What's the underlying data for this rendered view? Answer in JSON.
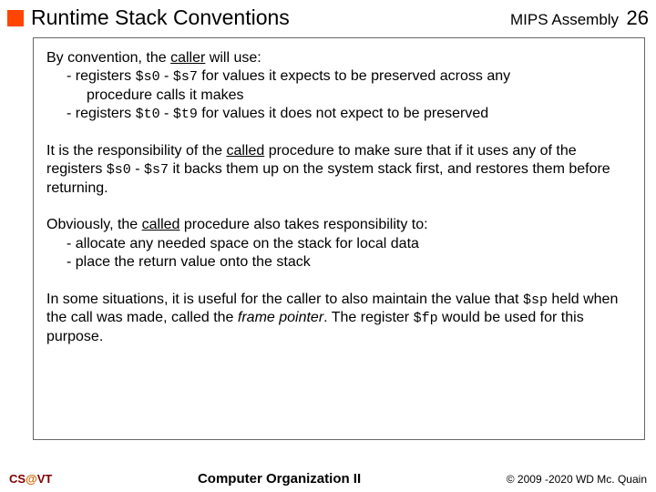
{
  "header": {
    "title": "Runtime Stack Conventions",
    "subject": "MIPS Assembly",
    "page": "26"
  },
  "body": {
    "p1_lead": "By convention, the ",
    "p1_caller": "caller",
    "p1_tail": " will use:",
    "b1_a": "-  registers ",
    "b1_reg1": "$s0",
    "b1_mid": " - ",
    "b1_reg2": "$s7",
    "b1_b": " for values it expects to be preserved across any",
    "b1_c": "procedure calls it makes",
    "b2_a": "-  registers ",
    "b2_reg1": "$t0",
    "b2_mid": " - ",
    "b2_reg2": "$t9",
    "b2_b": " for values it does not expect to be preserved",
    "p2_a": "It is the responsibility of the ",
    "p2_called": "called",
    "p2_b": " procedure to make sure that if it uses any of the registers ",
    "p2_reg1": "$s0",
    "p2_mid": " - ",
    "p2_reg2": "$s7",
    "p2_c": " it backs them up on the system stack first, and restores them before returning.",
    "p3_a": "Obviously, the ",
    "p3_called": "called",
    "p3_b": " procedure also takes responsibility to:",
    "b3": "-  allocate any needed space on the stack for local data",
    "b4": "-  place the return value onto the stack",
    "p4_a": "In some situations, it is useful for the caller to also maintain the value that ",
    "p4_sp": "$sp",
    "p4_b": " held when the call was made, called the ",
    "p4_fpname": "frame pointer",
    "p4_c": ".  The register ",
    "p4_fp": "$fp",
    "p4_d": " would be used for this purpose."
  },
  "footer": {
    "cs": "CS",
    "at": "@",
    "vt": "VT",
    "center": "Computer Organization II",
    "right": "© 2009 -2020 WD Mc. Quain"
  }
}
